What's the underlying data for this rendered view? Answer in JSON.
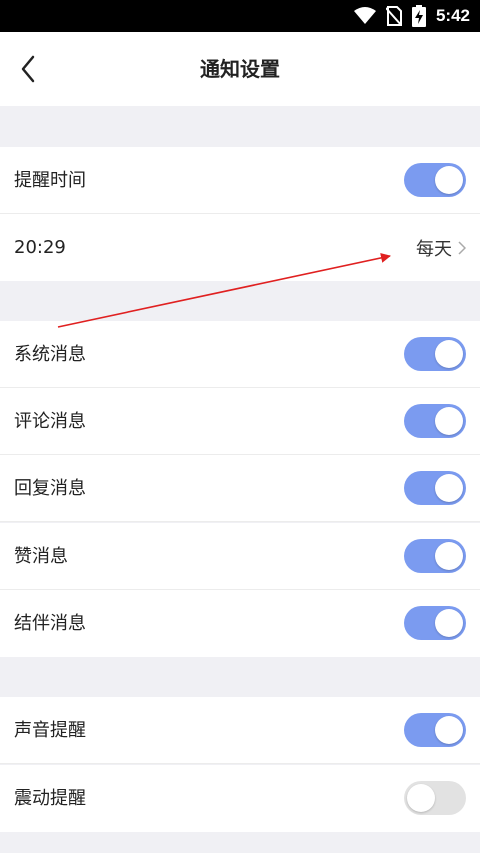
{
  "status_bar": {
    "time": "5:42"
  },
  "header": {
    "title": "通知设置"
  },
  "reminder": {
    "label": "提醒时间",
    "enabled": true,
    "time": "20:29",
    "frequency": "每天"
  },
  "message_settings": [
    {
      "key": "system",
      "label": "系统消息",
      "enabled": true
    },
    {
      "key": "comment",
      "label": "评论消息",
      "enabled": true
    },
    {
      "key": "reply",
      "label": "回复消息",
      "enabled": true
    },
    {
      "key": "like",
      "label": "赞消息",
      "enabled": true
    },
    {
      "key": "partner",
      "label": "结伴消息",
      "enabled": true
    }
  ],
  "alert_settings": [
    {
      "key": "sound",
      "label": "声音提醒",
      "enabled": true
    },
    {
      "key": "vibrate",
      "label": "震动提醒",
      "enabled": false
    }
  ],
  "colors": {
    "toggle_on": "#7b9bf0",
    "toggle_off": "#e2e2e2",
    "annotation_arrow": "#e02020"
  }
}
